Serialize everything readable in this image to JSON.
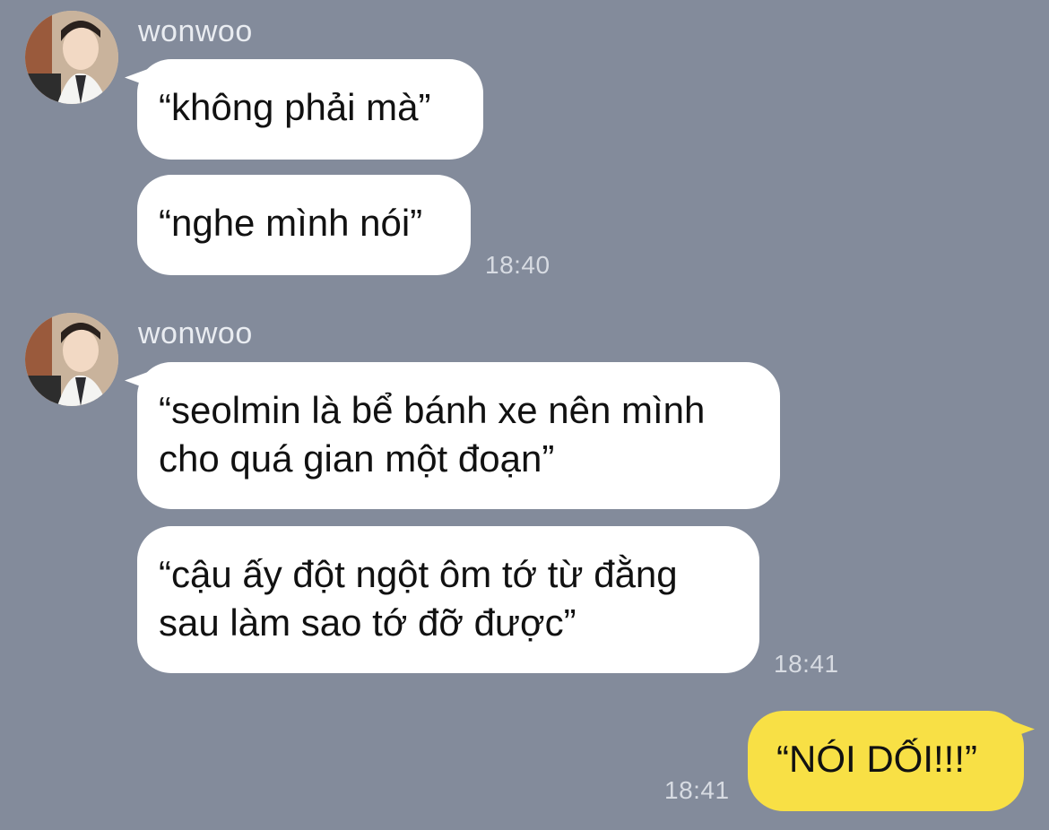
{
  "chat": {
    "groups": [
      {
        "sender": "wonwoo",
        "messages": [
          "“không phải mà”",
          "“nghe mình nói”"
        ],
        "time": "18:40"
      },
      {
        "sender": "wonwoo",
        "messages": [
          "“seolmin là bể bánh xe nên mình\ncho quá gian một đoạn”",
          "“cậu ấy đột ngột ôm tớ từ đằng\nsau làm sao tớ đỡ được”"
        ],
        "time": "18:41"
      }
    ],
    "outgoing": {
      "message": "“NÓI DỐI!!!”",
      "time": "18:41"
    }
  },
  "colors": {
    "background": "#838b9b",
    "incoming_bubble": "#ffffff",
    "outgoing_bubble": "#f8e045"
  },
  "icons": {
    "avatar": "profile-photo"
  }
}
